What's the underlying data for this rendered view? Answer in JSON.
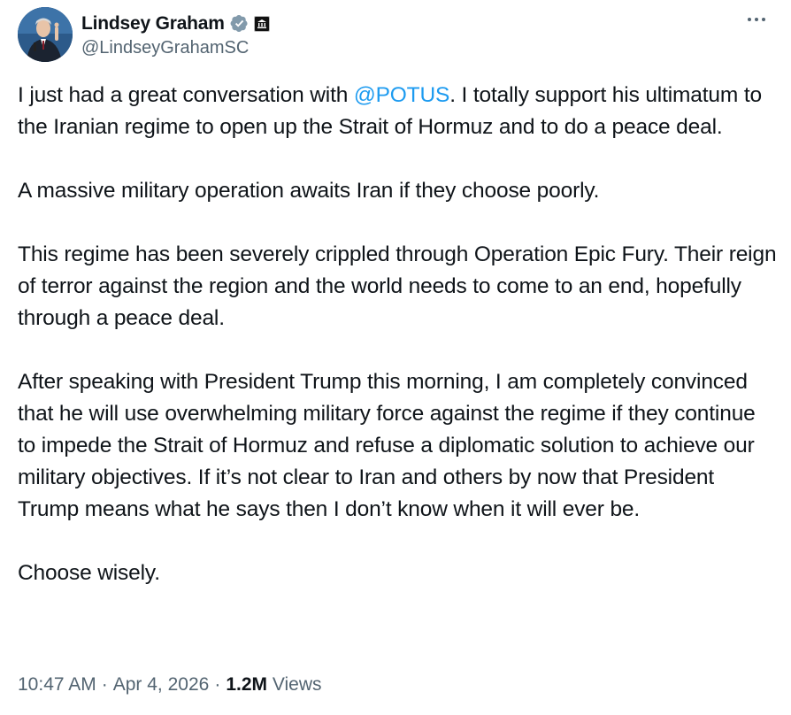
{
  "author": {
    "display_name": "Lindsey Graham",
    "handle": "@LindseyGrahamSC",
    "verified_icon": "verified-badge-icon",
    "affiliation_icon": "government-building-icon"
  },
  "more_icon": "more-horizontal-icon",
  "tweet": {
    "p1_before": "I just had a great conversation with ",
    "p1_mention": "@POTUS",
    "p1_after": ". I totally support his ultimatum to the Iranian regime to open up the Strait of Hormuz and to do a peace deal.",
    "p2": "A massive military operation awaits Iran if they choose poorly.",
    "p3": "This regime has been severely crippled through Operation Epic Fury. Their reign of terror against the region and the world needs to come to an end, hopefully through a peace deal.",
    "p4": "After speaking with President Trump this morning, I am completely convinced that he will use overwhelming military force against the regime if they continue to impede the Strait of Hormuz and refuse a diplomatic solution to achieve our military objectives. If it’s not clear to Iran and others by now that President Trump means what he says then I don’t know when it will ever be.",
    "p5": "Choose wisely."
  },
  "meta": {
    "time": "10:47 AM",
    "separator": "·",
    "date": "Apr 4, 2026",
    "views_count": "1.2M",
    "views_label": "Views"
  },
  "colors": {
    "link": "#1d9bf0",
    "text": "#0f1419",
    "secondary": "#536471",
    "verified": "#829aab"
  }
}
